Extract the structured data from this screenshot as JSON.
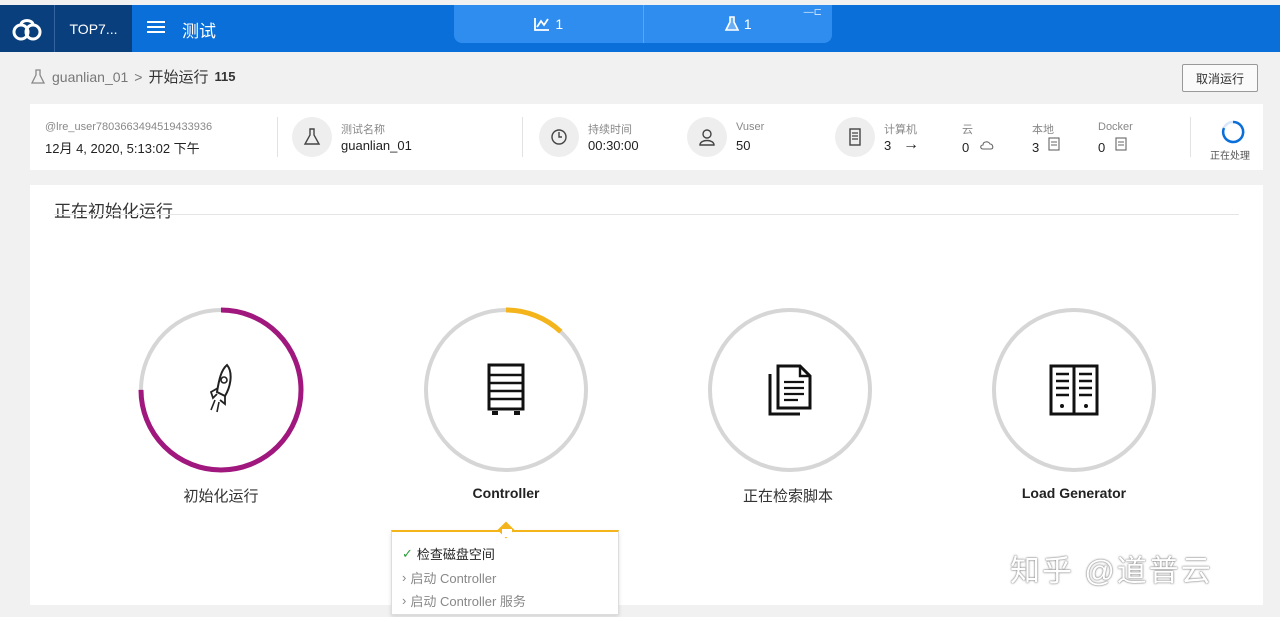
{
  "header": {
    "project": "TOP7...",
    "title": "测试",
    "tabs": [
      {
        "icon": "run-chart-icon",
        "count": "1"
      },
      {
        "icon": "flask-icon",
        "count": "1"
      }
    ]
  },
  "breadcrumb": {
    "test_name": "guanlian_01",
    "separator": ">",
    "current": "开始运行",
    "run_id": "115"
  },
  "cancel_label": "取消运行",
  "info": {
    "user": "@lre_user7803663494519433936",
    "datetime": "12月 4, 2020, 5:13:02 下午",
    "test_name_label": "测试名称",
    "test_name": "guanlian_01",
    "duration_label": "持续时间",
    "duration": "00:30:00",
    "vuser_label": "Vuser",
    "vuser": "50",
    "machines_label": "计算机",
    "machines": "3",
    "cloud_label": "云",
    "cloud": "0",
    "local_label": "本地",
    "local": "3",
    "docker_label": "Docker",
    "docker": "0",
    "status": "正在处理"
  },
  "main": {
    "section_title": "正在初始化运行",
    "stages": [
      {
        "label": "初始化运行",
        "progress": 0.75,
        "color": "#a0177e"
      },
      {
        "label": "Controller",
        "progress": 0.12,
        "color": "#f3b51b"
      },
      {
        "label": "正在检索脚本",
        "progress": 0,
        "color": "#cccccc"
      },
      {
        "label": "Load Generator",
        "progress": 0,
        "color": "#cccccc"
      }
    ],
    "steps": [
      {
        "label": "检查磁盘空间",
        "done": true
      },
      {
        "label": "启动 Controller",
        "done": false
      },
      {
        "label": "启动 Controller 服务",
        "done": false
      }
    ]
  },
  "watermark": "知乎 @道普云",
  "colors": {
    "header": "#0a6fd9",
    "header_dark": "#0a3f7e",
    "tab_bar": "#2f8df0",
    "init": "#a0177e",
    "controller": "#f3b51b"
  }
}
